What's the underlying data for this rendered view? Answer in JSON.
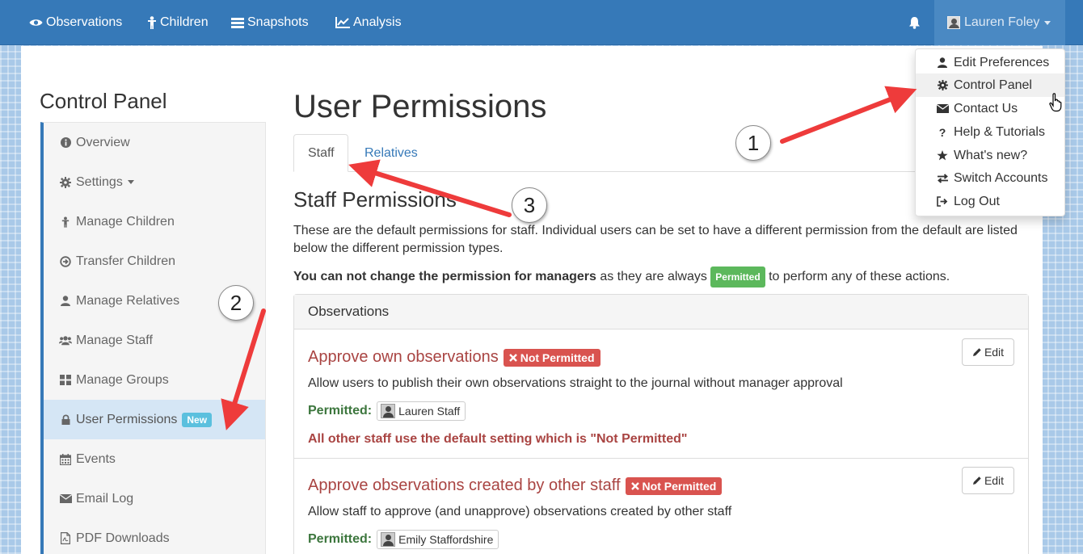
{
  "navbar": {
    "items": [
      {
        "label": "Observations",
        "icon": "eye-icon"
      },
      {
        "label": "Children",
        "icon": "child-icon"
      },
      {
        "label": "Snapshots",
        "icon": "list-icon"
      },
      {
        "label": "Analysis",
        "icon": "line-chart-icon"
      }
    ],
    "notifications_icon": "bell-icon",
    "user_name": "Lauren Foley"
  },
  "user_menu": {
    "items": [
      {
        "label": "Edit Preferences",
        "icon": "user-icon"
      },
      {
        "label": "Control Panel",
        "icon": "gear-icon"
      },
      {
        "label": "Contact Us",
        "icon": "envelope-icon"
      },
      {
        "label": "Help & Tutorials",
        "icon": "question-icon"
      },
      {
        "label": "What's new?",
        "icon": "star-icon"
      },
      {
        "label": "Switch Accounts",
        "icon": "exchange-icon"
      },
      {
        "label": "Log Out",
        "icon": "sign-out-icon"
      }
    ]
  },
  "sidebar": {
    "title": "Control Panel",
    "items": [
      {
        "label": "Overview",
        "icon": "info-icon"
      },
      {
        "label": "Settings",
        "icon": "gear-icon"
      },
      {
        "label": "Manage Children",
        "icon": "child-icon"
      },
      {
        "label": "Transfer Children",
        "icon": "transfer-icon"
      },
      {
        "label": "Manage Relatives",
        "icon": "user-icon"
      },
      {
        "label": "Manage Staff",
        "icon": "users-icon"
      },
      {
        "label": "Manage Groups",
        "icon": "grid-icon"
      },
      {
        "label": "User Permissions",
        "icon": "lock-icon",
        "badge": "New"
      },
      {
        "label": "Events",
        "icon": "calendar-icon"
      },
      {
        "label": "Email Log",
        "icon": "envelope-icon"
      },
      {
        "label": "PDF Downloads",
        "icon": "pdf-icon"
      }
    ]
  },
  "main": {
    "title": "User Permissions",
    "tabs": [
      {
        "label": "Staff"
      },
      {
        "label": "Relatives"
      }
    ],
    "section_title": "Staff Permissions",
    "intro_line1": "These are the default permissions for staff. Individual users can be set to have a different permission from the default are listed",
    "intro_line2": "below the different permission types.",
    "managers_bold": "You can not change the permission for managers",
    "managers_mid": " as they are always ",
    "managers_badge": "Permitted",
    "managers_end": " to perform any of these actions.",
    "panel_heading": "Observations",
    "permissions": [
      {
        "title": "Approve own observations",
        "status": "Not Permitted",
        "description": "Allow users to publish their own observations straight to the journal without manager approval",
        "permitted_label": "Permitted:",
        "permitted_user": "Lauren Staff",
        "default_note": "All other staff use the default setting which is \"Not Permitted\"",
        "edit_label": "Edit"
      },
      {
        "title": "Approve observations created by other staff",
        "status": "Not Permitted",
        "description": "Allow staff to approve (and unapprove) observations created by other staff",
        "permitted_label": "Permitted:",
        "permitted_user": "Emily Staffordshire",
        "edit_label": "Edit"
      }
    ]
  },
  "annotations": {
    "callouts": [
      "1",
      "2",
      "3"
    ],
    "arrow_color": "#ee3b3b"
  },
  "colors": {
    "navbar": "#3679b8",
    "danger": "#d9534f",
    "success": "#5cb85c",
    "info": "#5bc0de",
    "danger_text": "#a94442",
    "success_text": "#3c763d"
  }
}
